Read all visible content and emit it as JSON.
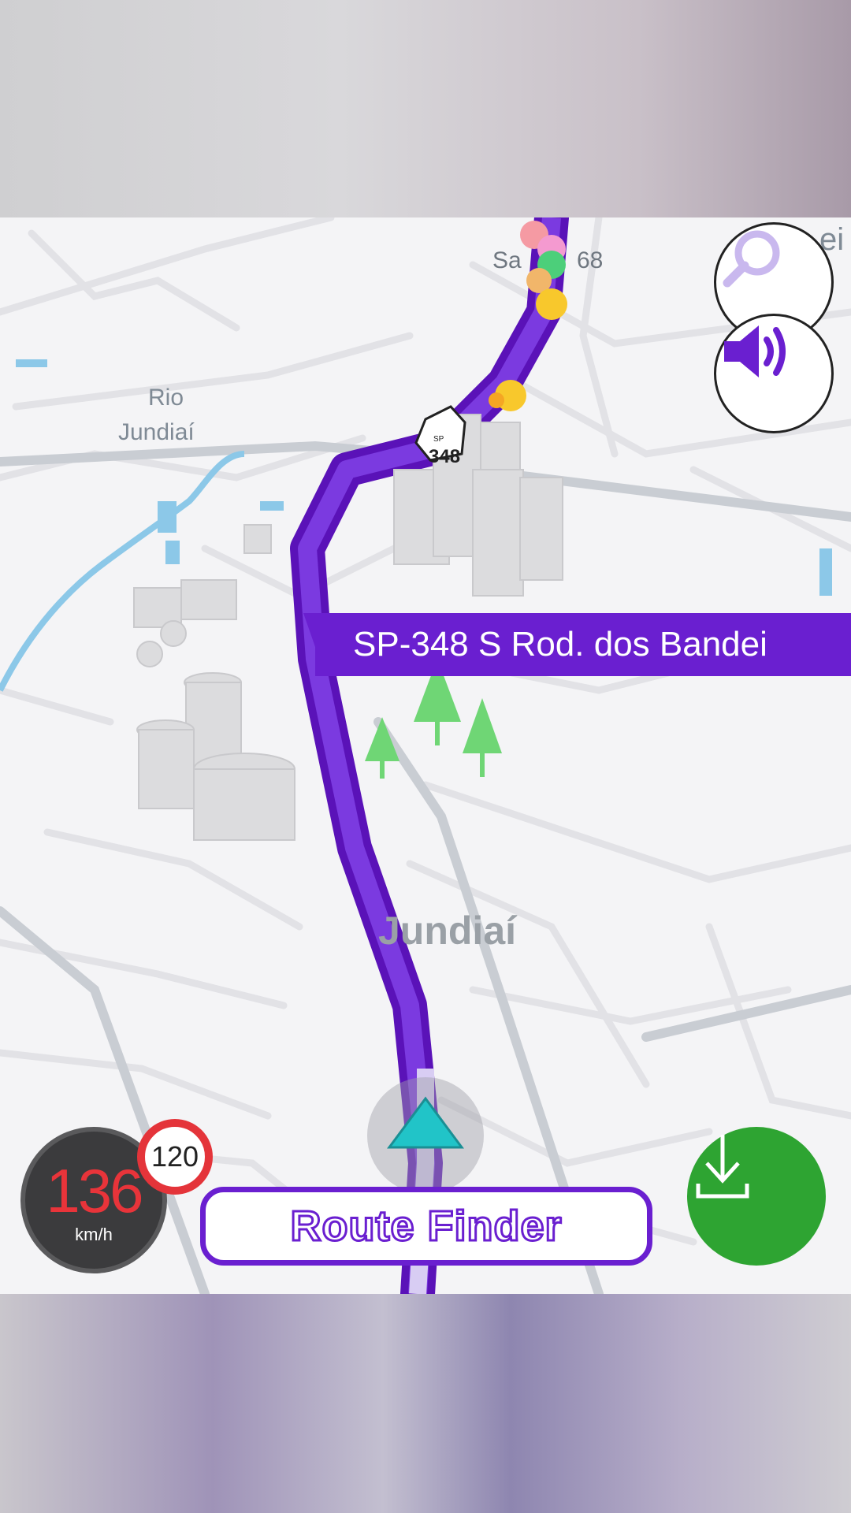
{
  "map": {
    "place_labels": [
      "Sa",
      "68",
      "Rio",
      "Jundiaí",
      "ei"
    ],
    "city_label": "Jundiaí",
    "shield_number": "348",
    "shield_prefix": "SP",
    "road_banner": "SP-348 S Rod. dos Bandei",
    "route_color": "#6a1fd0"
  },
  "controls": {
    "search_icon": "search-icon",
    "sound_icon": "speaker-icon",
    "download_icon": "download-icon"
  },
  "speedometer": {
    "speed": "136",
    "unit": "km/h",
    "limit": "120"
  },
  "bottom": {
    "pill_label": "Route Finder"
  }
}
